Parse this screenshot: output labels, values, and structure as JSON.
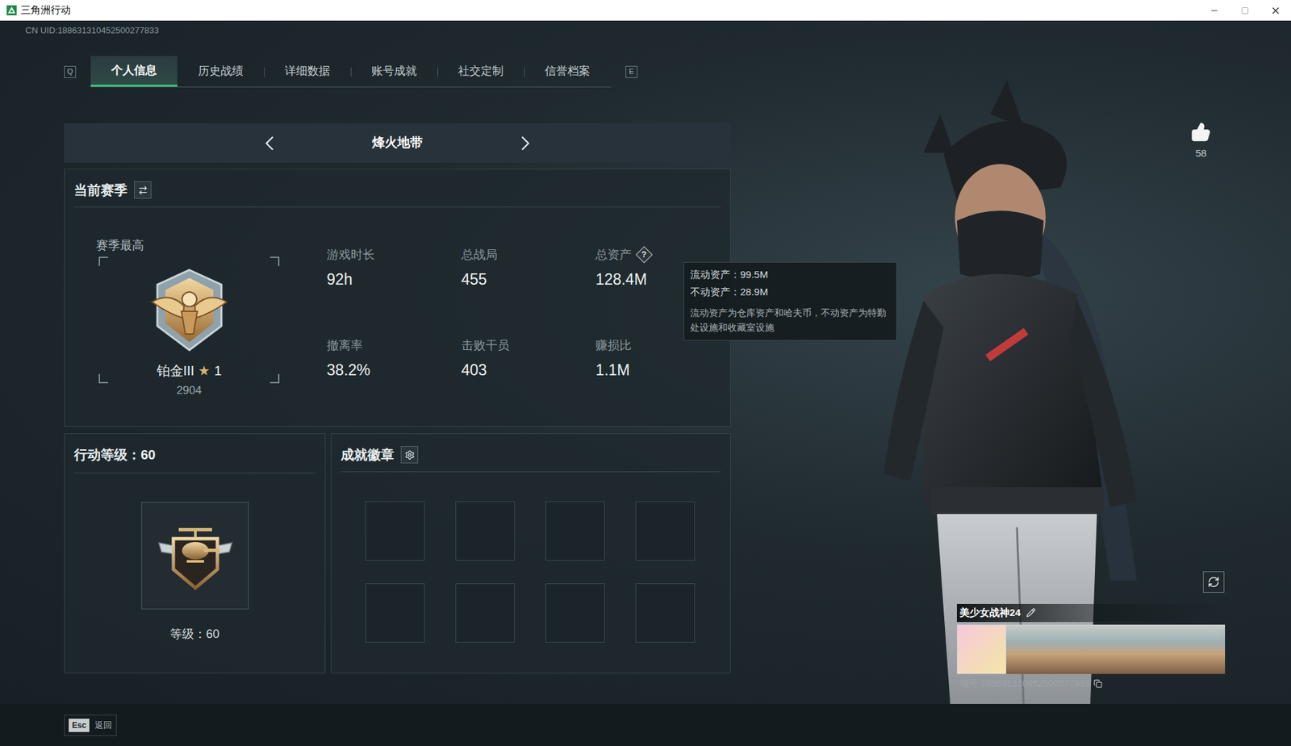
{
  "window": {
    "title": "三角洲行动"
  },
  "uid": "CN UID:188631310452500277833",
  "tab_keys": {
    "prev": "Q",
    "next": "E"
  },
  "tabs": [
    {
      "label": "个人信息",
      "selected": true
    },
    {
      "label": "历史战绩",
      "selected": false
    },
    {
      "label": "详细数据",
      "selected": false
    },
    {
      "label": "账号成就",
      "selected": false
    },
    {
      "label": "社交定制",
      "selected": false
    },
    {
      "label": "信誉档案",
      "selected": false
    }
  ],
  "mode": {
    "label": "烽火地带"
  },
  "season": {
    "title": "当前赛季",
    "best_label": "赛季最高",
    "rank": "铂金III",
    "star": "★",
    "star_count": "1",
    "score": "2904",
    "help_icon": "?",
    "stats": [
      {
        "label": "游戏时长",
        "value": "92h",
        "help": false
      },
      {
        "label": "总战局",
        "value": "455",
        "help": false
      },
      {
        "label": "总资产",
        "value": "128.4M",
        "help": true
      },
      {
        "label": "撤离率",
        "value": "38.2%",
        "help": false
      },
      {
        "label": "击败干员",
        "value": "403",
        "help": false
      },
      {
        "label": "赚损比",
        "value": "1.1M",
        "help": false
      }
    ]
  },
  "tooltip": {
    "lines": [
      "流动资产：99.5M",
      "不动资产：28.9M"
    ],
    "note": "流动资产为仓库资产和哈夫币，不动资产为特勤处设施和收藏室设施"
  },
  "level": {
    "title": "行动等级：60",
    "caption": "等级：60"
  },
  "achievements": {
    "title": "成就徽章",
    "slots": [
      {
        "filled": false
      },
      {
        "filled": false
      },
      {
        "filled": false
      },
      {
        "filled": false
      },
      {
        "filled": false
      },
      {
        "filled": false
      },
      {
        "filled": false
      },
      {
        "filled": false
      }
    ]
  },
  "likes": {
    "count": "58"
  },
  "profile": {
    "name": "美少女战神24",
    "id": "编号 188631310452500277833"
  },
  "footer": {
    "key": "Esc",
    "label": "返回"
  }
}
